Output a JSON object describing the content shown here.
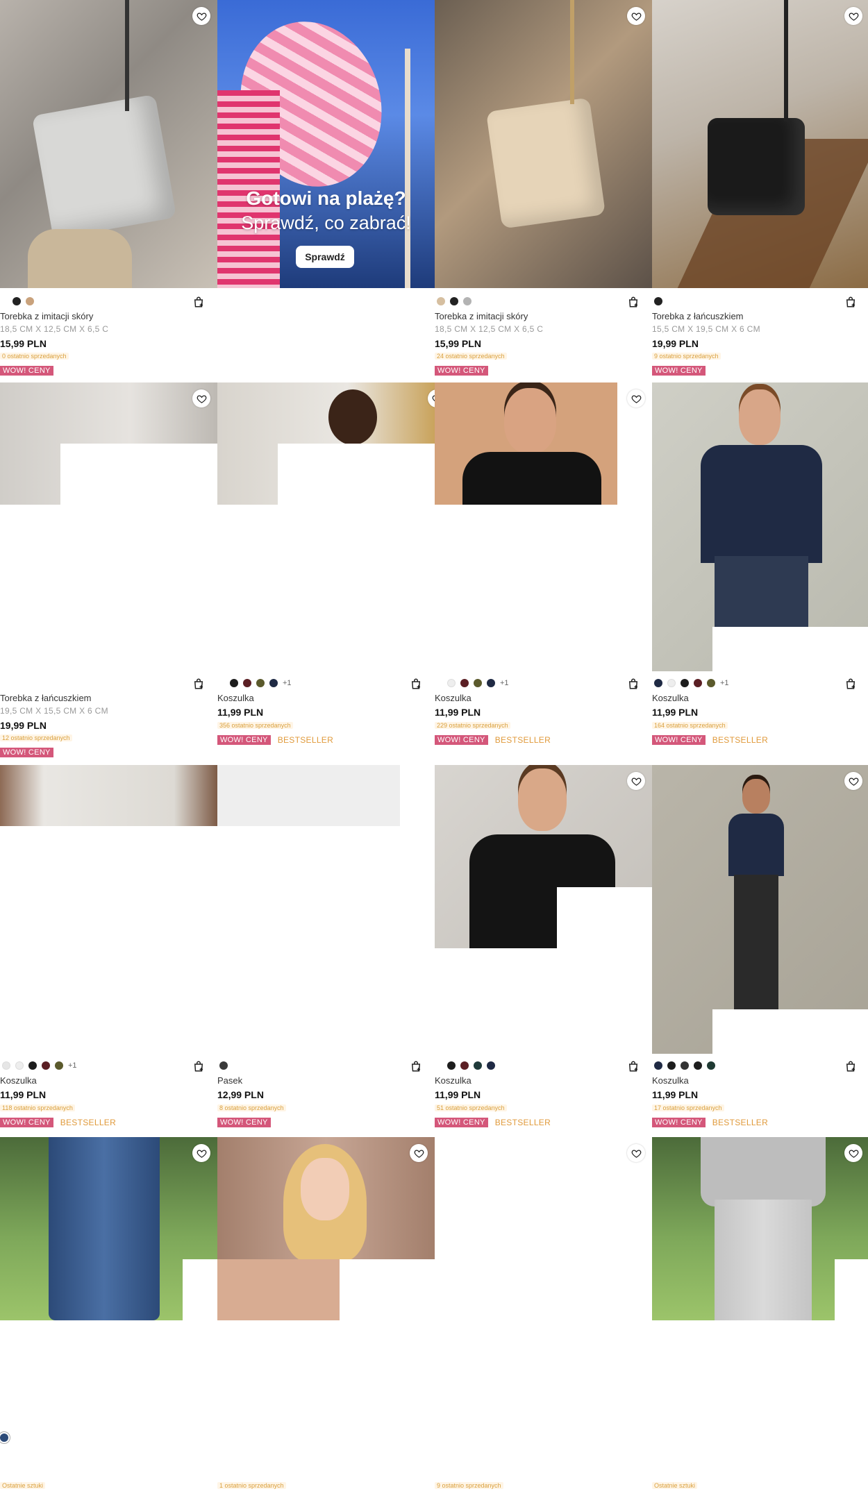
{
  "banner": {
    "line1": "Gotowi na plażę?",
    "line2": "Sprawdź, co zabrać!",
    "button": "Sprawdź"
  },
  "colors": {
    "wow_bg": "#d4577a",
    "bestseller": "#e09a3b",
    "sold_text": "#d9a03e"
  },
  "products": [
    {
      "name": "Torebka z imitacji skóry",
      "dims": "18,5 CM X 12,5 CM X 6,5 C",
      "price": "15,99 PLN",
      "sold": "0 ostatnio sprzedanych",
      "wow": "WOW! CENY",
      "bestseller": "",
      "swatches": [
        "#222222",
        "#c9a27c"
      ],
      "more": ""
    },
    {
      "name": "Torebka z imitacji skóry",
      "dims": "18,5 CM X 12,5 CM X 6,5 C",
      "price": "15,99 PLN",
      "sold": "24 ostatnio sprzedanych",
      "wow": "WOW! CENY",
      "bestseller": "",
      "swatches": [
        "#d6bfa0",
        "#222222",
        "#b3b3b3"
      ],
      "more": ""
    },
    {
      "name": "Torebka z łańcuszkiem",
      "dims": "15,5 CM X 19,5 CM X 6 CM",
      "price": "19,99 PLN",
      "sold": "9 ostatnio sprzedanych",
      "wow": "WOW! CENY",
      "bestseller": "",
      "swatches": [
        "#222222"
      ],
      "more": ""
    },
    {
      "name": "Torebka z łańcuszkiem",
      "dims": "19,5 CM X 15,5 CM X 6 CM",
      "price": "19,99 PLN",
      "sold": "12 ostatnio sprzedanych",
      "wow": "WOW! CENY",
      "bestseller": "",
      "swatches": [],
      "more": ""
    },
    {
      "name": "Koszulka",
      "dims": "",
      "price": "11,99 PLN",
      "sold": "356 ostatnio sprzedanych",
      "wow": "WOW! CENY",
      "bestseller": "BESTSELLER",
      "swatches": [
        "#1d1d1d",
        "#5b1f24",
        "#5b5a2c",
        "#1f2a44"
      ],
      "more": "+1"
    },
    {
      "name": "Koszulka",
      "dims": "",
      "price": "11,99 PLN",
      "sold": "229 ostatnio sprzedanych",
      "wow": "WOW! CENY",
      "bestseller": "BESTSELLER",
      "swatches": [
        "#eeeeee",
        "#5b1f24",
        "#5b5a2c",
        "#1f2a44"
      ],
      "more": "+1"
    },
    {
      "name": "Koszulka",
      "dims": "",
      "price": "11,99 PLN",
      "sold": "164 ostatnio sprzedanych",
      "wow": "WOW! CENY",
      "bestseller": "BESTSELLER",
      "swatches": [
        "#1f2a44",
        "#eeeeee",
        "#1d1d1d",
        "#5b1f24",
        "#5b5a2c"
      ],
      "more": "+1"
    },
    {
      "name": "Koszulka",
      "dims": "",
      "price": "11,99 PLN",
      "sold": "118 ostatnio sprzedanych",
      "wow": "WOW! CENY",
      "bestseller": "BESTSELLER",
      "swatches": [
        "#e6e6e6",
        "#eeeeee",
        "#1d1d1d",
        "#5b1f24",
        "#5b5a2c"
      ],
      "more": "+1"
    },
    {
      "name": "Pasek",
      "dims": "",
      "price": "12,99 PLN",
      "sold": "8 ostatnio sprzedanych",
      "wow": "WOW! CENY",
      "bestseller": "",
      "swatches": [
        "#3a3a3a"
      ],
      "more": ""
    },
    {
      "name": "Koszulka",
      "dims": "",
      "price": "11,99 PLN",
      "sold": "51 ostatnio sprzedanych",
      "wow": "WOW! CENY",
      "bestseller": "BESTSELLER",
      "swatches": [
        "#1d1d1d",
        "#5b1f24",
        "#1f3a3a",
        "#1f2a44"
      ],
      "more": ""
    },
    {
      "name": "Koszulka",
      "dims": "",
      "price": "11,99 PLN",
      "sold": "17 ostatnio sprzedanych",
      "wow": "WOW! CENY",
      "bestseller": "BESTSELLER",
      "swatches": [
        "#1f2a44",
        "#1d1d1d",
        "#333333",
        "#1d1d1d",
        "#1f3a33"
      ],
      "more": ""
    }
  ],
  "bottom_sold": [
    "Ostatnie sztuki",
    "1 ostatnio sprzedanych",
    "9 ostatnio sprzedanych",
    "Ostatnie sztuki"
  ]
}
